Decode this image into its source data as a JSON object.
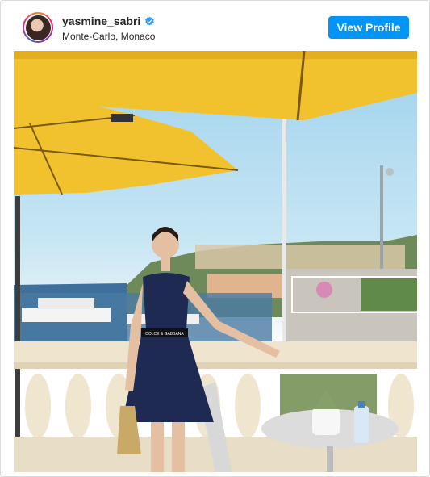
{
  "post": {
    "username": "yasmine_sabri",
    "location": "Monte-Carlo, Monaco",
    "verified": true,
    "view_profile_label": "View Profile"
  },
  "photo": {
    "label_on_belt": "DOLCE & GABBANA"
  },
  "colors": {
    "button": "#0095f6",
    "verified_badge": "#3897f0",
    "umbrella": "#f2c12e",
    "dress": "#1e2a52"
  },
  "icons": {
    "verified": "verified-badge-icon"
  }
}
